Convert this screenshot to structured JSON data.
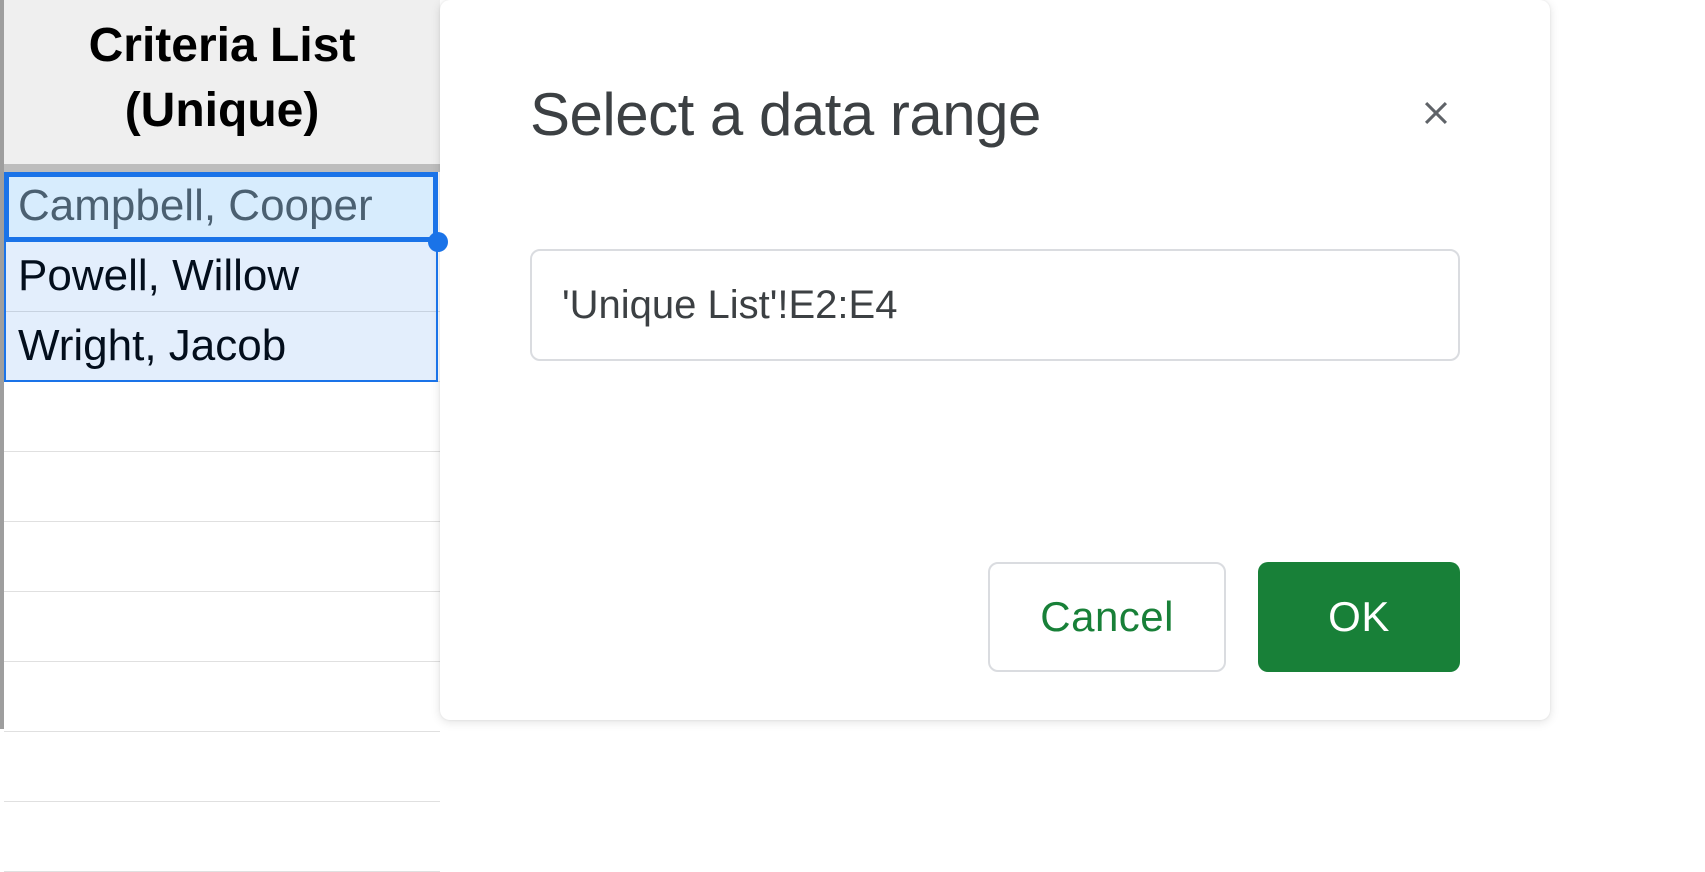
{
  "spreadsheet": {
    "header_line1": "Criteria List",
    "header_line2": "(Unique)",
    "rows": [
      "Campbell, Cooper",
      "Powell, Willow",
      "Wright, Jacob"
    ]
  },
  "dialog": {
    "title": "Select a data range",
    "range_value": "'Unique List'!E2:E4",
    "cancel_label": "Cancel",
    "ok_label": "OK"
  }
}
